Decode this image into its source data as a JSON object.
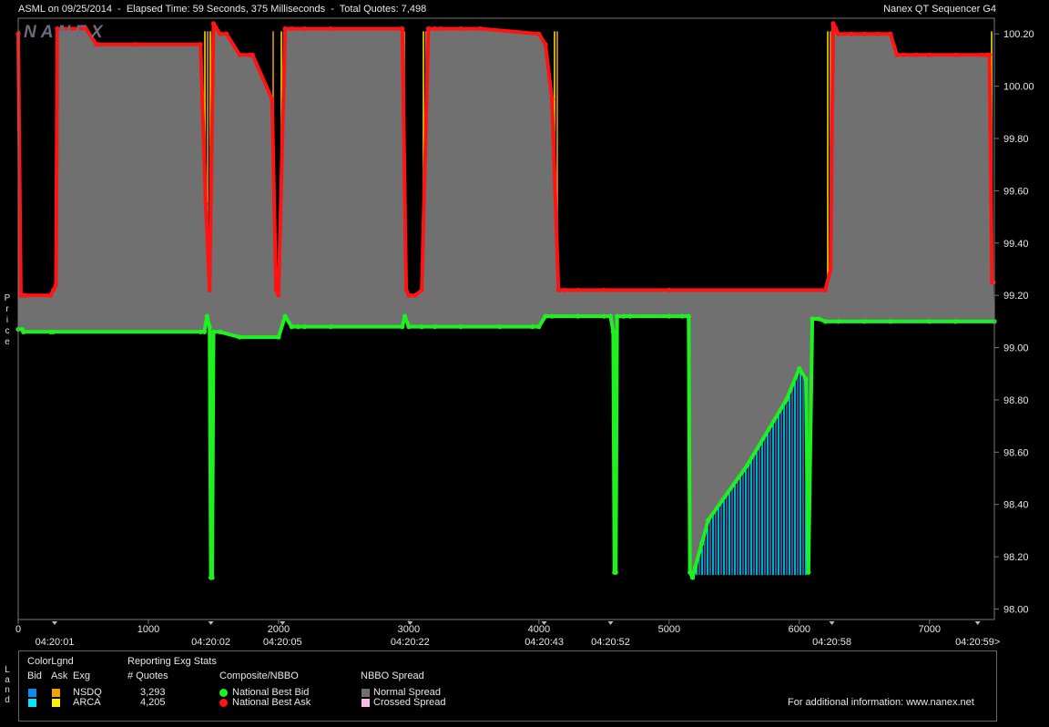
{
  "header": {
    "left_text": "ASML on 09/25/2014  -  Elapsed Time: 59 Seconds, 375 Milliseconds  -  Total Quotes: 7,498",
    "right_text": "Nanex QT Sequencer G4"
  },
  "logo_text": "NANEX",
  "y_axis_title": [
    "P",
    "r",
    "i",
    "c",
    "e"
  ],
  "legend_side_title": [
    "L",
    "a",
    "n",
    "d"
  ],
  "legend": {
    "headers": {
      "color_legend": "ColorLgnd",
      "bid": "Bid",
      "ask": "Ask",
      "exg": "Exg",
      "reporting": "Reporting Exg Stats",
      "quotes": "# Quotes",
      "composite": "Composite/NBBO",
      "spread": "NBBO Spread"
    },
    "exchanges": [
      {
        "name": "NSDQ",
        "quotes": "3,293",
        "bid_color": "#0a8ef0",
        "ask_color": "#f5a300"
      },
      {
        "name": "ARCA",
        "quotes": "4,205",
        "bid_color": "#00e8ff",
        "ask_color": "#fff200"
      }
    ],
    "composite": [
      {
        "label": "National Best Bid",
        "color": "#1ef21e"
      },
      {
        "label": "National Best Ask",
        "color": "#ff1414"
      }
    ],
    "spread": [
      {
        "label": "Normal Spread",
        "color": "#707070"
      },
      {
        "label": "Crossed Spread",
        "color": "#ffb8e8"
      }
    ],
    "footer": "For additional information: www.nanex.net"
  },
  "chart_data": {
    "type": "line",
    "title": "ASML on 09/25/2014",
    "xlabel": "",
    "ylabel": "Price",
    "xlim": [
      0,
      7498
    ],
    "ylim": [
      97.96,
      100.26
    ],
    "x_ticks": [
      0,
      1000,
      2000,
      3000,
      4000,
      5000,
      6000,
      7000
    ],
    "y_ticks": [
      98.0,
      98.2,
      98.4,
      98.6,
      98.8,
      99.0,
      99.2,
      99.4,
      99.6,
      99.8,
      100.0,
      100.2
    ],
    "time_labels": [
      {
        "x": 280,
        "label": "04:20:01"
      },
      {
        "x": 1480,
        "label": "04:20:02"
      },
      {
        "x": 2030,
        "label": "04:20:05"
      },
      {
        "x": 3010,
        "label": "04:20:22"
      },
      {
        "x": 4040,
        "label": "04:20:43"
      },
      {
        "x": 4550,
        "label": "04:20:52"
      },
      {
        "x": 6250,
        "label": "04:20:58"
      },
      {
        "x": 7370,
        "label": "04:20:59>"
      }
    ],
    "grid": false,
    "series": [
      {
        "name": "National Best Ask",
        "color": "#ff1414",
        "x": [
          0,
          20,
          40,
          60,
          250,
          270,
          290,
          300,
          520,
          600,
          620,
          900,
          1400,
          1440,
          1470,
          1500,
          1550,
          1600,
          1700,
          1780,
          1800,
          1950,
          1980,
          2000,
          2050,
          2100,
          2200,
          2400,
          2950,
          2980,
          3000,
          3050,
          3100,
          3150,
          3200,
          3250,
          3400,
          3550,
          4000,
          4050,
          4100,
          4150,
          4200,
          4300,
          4500,
          5000,
          6200,
          6240,
          6260,
          6280,
          6300,
          6400,
          6500,
          6600,
          6700,
          6750,
          6800,
          6900,
          7000,
          7200,
          7400,
          7440,
          7460,
          7480,
          7490
        ],
        "y": [
          100.2,
          99.2,
          99.2,
          99.2,
          99.2,
          99.22,
          99.24,
          100.22,
          100.22,
          100.16,
          100.16,
          100.16,
          100.16,
          99.55,
          99.22,
          100.24,
          100.2,
          100.2,
          100.12,
          100.12,
          100.12,
          99.95,
          99.22,
          99.2,
          100.22,
          100.22,
          100.22,
          100.22,
          100.22,
          99.22,
          99.2,
          99.2,
          99.22,
          100.22,
          100.22,
          100.22,
          100.22,
          100.22,
          100.2,
          100.16,
          99.95,
          99.22,
          99.22,
          99.22,
          99.22,
          99.22,
          99.22,
          99.3,
          100.24,
          100.22,
          100.2,
          100.2,
          100.2,
          100.2,
          100.2,
          100.12,
          100.12,
          100.12,
          100.12,
          100.12,
          100.12,
          100.12,
          100.12,
          99.25,
          99.25
        ]
      },
      {
        "name": "National Best Bid",
        "color": "#1ef21e",
        "x": [
          0,
          30,
          40,
          250,
          270,
          1400,
          1430,
          1450,
          1470,
          1480,
          1490,
          1500,
          1550,
          1700,
          2000,
          2050,
          2100,
          2150,
          2200,
          2400,
          2950,
          2970,
          3000,
          3100,
          3200,
          3400,
          3700,
          3950,
          4000,
          4050,
          4100,
          4300,
          4500,
          4550,
          4570,
          4580,
          4590,
          4600,
          4650,
          4700,
          5000,
          5100,
          5150,
          5160,
          5180,
          5200,
          5250,
          5300,
          5600,
          5900,
          6000,
          6050,
          6070,
          6100,
          6150,
          6200,
          6300,
          6500,
          6700,
          7000,
          7200,
          7498
        ],
        "y": [
          99.07,
          99.07,
          99.06,
          99.06,
          99.06,
          99.06,
          99.06,
          99.12,
          99.08,
          98.12,
          98.12,
          99.06,
          99.06,
          99.04,
          99.04,
          99.12,
          99.08,
          99.08,
          99.08,
          99.08,
          99.08,
          99.12,
          99.08,
          99.08,
          99.08,
          99.08,
          99.08,
          99.08,
          99.08,
          99.12,
          99.12,
          99.12,
          99.12,
          99.12,
          99.06,
          98.14,
          98.14,
          99.12,
          99.12,
          99.12,
          99.12,
          99.12,
          99.12,
          98.14,
          98.12,
          98.16,
          98.25,
          98.34,
          98.55,
          98.8,
          98.92,
          98.88,
          98.14,
          99.11,
          99.11,
          99.1,
          99.1,
          99.1,
          99.1,
          99.1,
          99.1,
          99.1
        ]
      }
    ],
    "colors": {
      "spread_fill": "#707070",
      "ask_hatch_a": "#ffea00",
      "ask_hatch_b": "#f5a300",
      "bid_hatch_a": "#00e8ff",
      "bid_hatch_b": "#0a8ef0",
      "frame": "#777777"
    }
  }
}
